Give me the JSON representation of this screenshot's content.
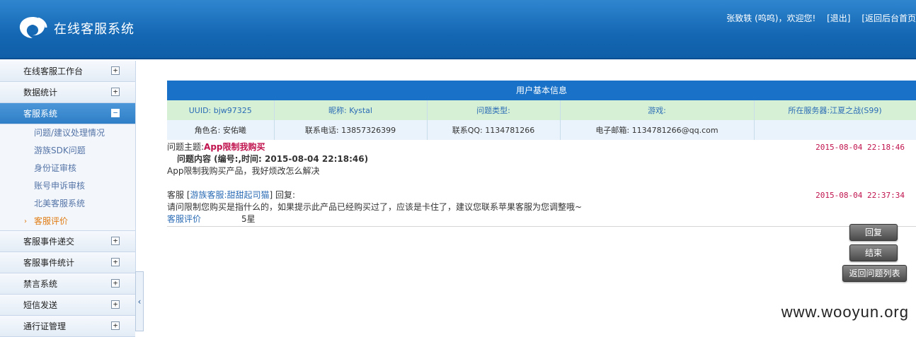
{
  "header": {
    "app_title": "在线客服系统",
    "greeting": "张致轶 (呜呜)，欢迎您!",
    "logout": "[退出]",
    "back_home": "[返回后台首页"
  },
  "sidebar": {
    "menus": [
      {
        "label": "在线客服工作台",
        "icon": "+"
      },
      {
        "label": "数据统计",
        "icon": "+"
      },
      {
        "label": "客服系统",
        "icon": "−"
      }
    ],
    "submenu": [
      {
        "label": "问题/建议处理情况"
      },
      {
        "label": "游族SDK问题"
      },
      {
        "label": "身份证审核"
      },
      {
        "label": "账号申诉审核"
      },
      {
        "label": "北美客服系统"
      },
      {
        "label": "客服评价"
      }
    ],
    "menus_after": [
      {
        "label": "客服事件递交",
        "icon": "+"
      },
      {
        "label": "客服事件统计",
        "icon": "+"
      },
      {
        "label": "禁言系统",
        "icon": "+"
      },
      {
        "label": "短信发送",
        "icon": "+"
      },
      {
        "label": "通行证管理",
        "icon": "+"
      }
    ],
    "collapse_arrow": "‹"
  },
  "info": {
    "title": "用户基本信息",
    "row1": [
      "UUID: bjw97325",
      "昵称: Kystal",
      "问题类型:",
      "游戏:",
      "所在服务器:江夏之战(S99)"
    ],
    "row2": [
      "角色名: 安佑曦",
      "联系电话: 13857326399",
      "联系QQ: 1134781266",
      "电子邮箱: 1134781266@qq.com",
      ""
    ]
  },
  "question": {
    "subject_label": "问题主题:",
    "subject": "App限制我购买",
    "date": "2015-08-04 22:18:46",
    "content_header": "问题内容 (编号:,时间: 2015-08-04 22:18:46)",
    "content": "App限制我购买产品，我好烦改怎么解决"
  },
  "reply": {
    "prefix": "客服 [",
    "agent": "游族客服:甜甜起司猫",
    "suffix": "] 回复:",
    "date": "2015-08-04 22:37:34",
    "content": "请问限制您购买是指什么的，如果提示此产品已经购买过了，应该是卡住了，建议您联系苹果客服为您调整哦~",
    "rating_label": "客服评价",
    "rating_value": "5星"
  },
  "buttons": {
    "reply": "回复",
    "close": "结束",
    "back": "返回问题列表"
  },
  "watermark": "www.wooyun.org",
  "colors": {
    "header_blue": "#1467b3",
    "accent_red": "#c0134d",
    "link_blue": "#2b6cb5",
    "active_orange": "#e07b12"
  }
}
